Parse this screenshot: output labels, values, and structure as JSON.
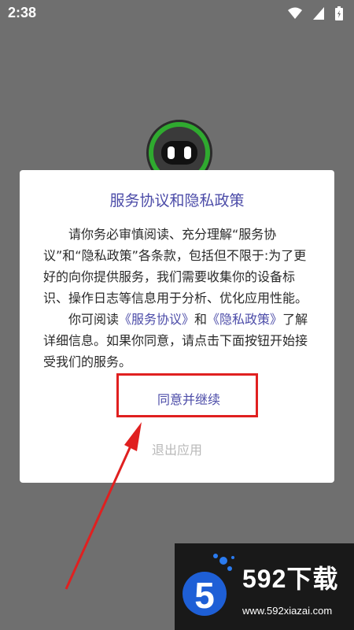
{
  "status_bar": {
    "time": "2:38",
    "icons": [
      "wifi-icon",
      "signal-icon",
      "battery-icon"
    ]
  },
  "dialog": {
    "title": "服务协议和隐私政策",
    "paragraph1": "请你务必审慎阅读、充分理解“服务协议”和“隐私政策”各条款，包括但不限于:为了更好的向你提供服务，我们需要收集你的设备标识、操作日志等信息用于分析、优化应用性能。",
    "paragraph2_prefix": "你可阅读",
    "service_link": "《服务协议》",
    "paragraph2_and": "和",
    "privacy_link": "《隐私政策》",
    "paragraph2_suffix": "了解详细信息。如果你同意，请点击下面按钮开始接受我们的服务。",
    "agree_label": "同意并继续",
    "exit_label": "退出应用"
  },
  "colors": {
    "accent": "#4c4ca8",
    "highlight": "#e02020",
    "overlay": "#6f6f6f"
  },
  "watermark": {
    "brand": "592下载",
    "url": "www.592xiazai.com",
    "logo_text": "5"
  }
}
